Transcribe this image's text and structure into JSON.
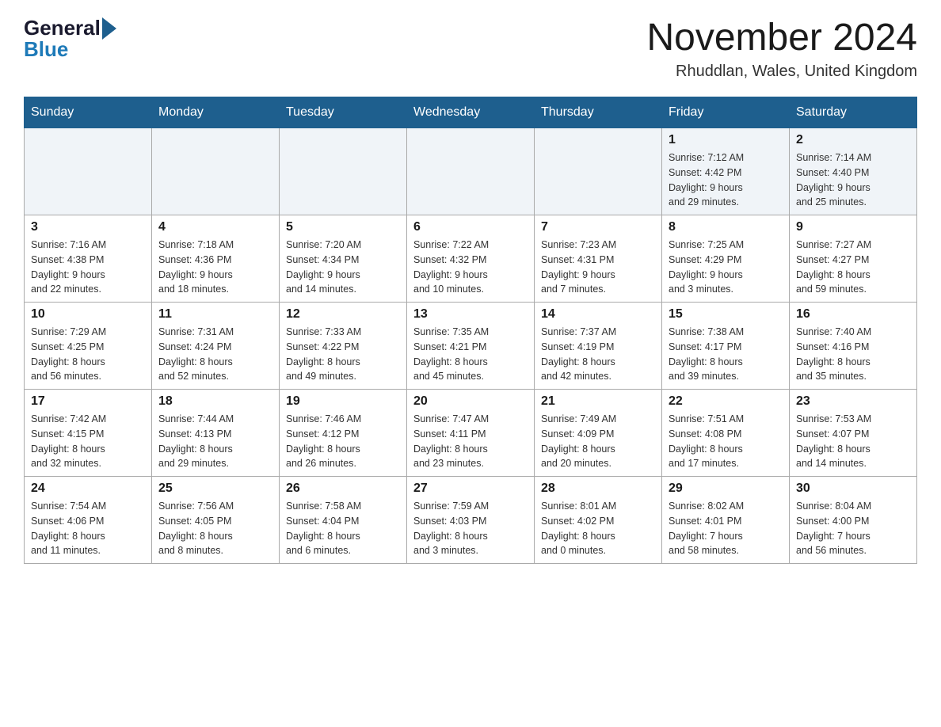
{
  "header": {
    "logo_general": "General",
    "logo_blue": "Blue",
    "month_title": "November 2024",
    "location": "Rhuddlan, Wales, United Kingdom"
  },
  "weekdays": [
    "Sunday",
    "Monday",
    "Tuesday",
    "Wednesday",
    "Thursday",
    "Friday",
    "Saturday"
  ],
  "weeks": [
    [
      {
        "day": "",
        "info": ""
      },
      {
        "day": "",
        "info": ""
      },
      {
        "day": "",
        "info": ""
      },
      {
        "day": "",
        "info": ""
      },
      {
        "day": "",
        "info": ""
      },
      {
        "day": "1",
        "info": "Sunrise: 7:12 AM\nSunset: 4:42 PM\nDaylight: 9 hours\nand 29 minutes."
      },
      {
        "day": "2",
        "info": "Sunrise: 7:14 AM\nSunset: 4:40 PM\nDaylight: 9 hours\nand 25 minutes."
      }
    ],
    [
      {
        "day": "3",
        "info": "Sunrise: 7:16 AM\nSunset: 4:38 PM\nDaylight: 9 hours\nand 22 minutes."
      },
      {
        "day": "4",
        "info": "Sunrise: 7:18 AM\nSunset: 4:36 PM\nDaylight: 9 hours\nand 18 minutes."
      },
      {
        "day": "5",
        "info": "Sunrise: 7:20 AM\nSunset: 4:34 PM\nDaylight: 9 hours\nand 14 minutes."
      },
      {
        "day": "6",
        "info": "Sunrise: 7:22 AM\nSunset: 4:32 PM\nDaylight: 9 hours\nand 10 minutes."
      },
      {
        "day": "7",
        "info": "Sunrise: 7:23 AM\nSunset: 4:31 PM\nDaylight: 9 hours\nand 7 minutes."
      },
      {
        "day": "8",
        "info": "Sunrise: 7:25 AM\nSunset: 4:29 PM\nDaylight: 9 hours\nand 3 minutes."
      },
      {
        "day": "9",
        "info": "Sunrise: 7:27 AM\nSunset: 4:27 PM\nDaylight: 8 hours\nand 59 minutes."
      }
    ],
    [
      {
        "day": "10",
        "info": "Sunrise: 7:29 AM\nSunset: 4:25 PM\nDaylight: 8 hours\nand 56 minutes."
      },
      {
        "day": "11",
        "info": "Sunrise: 7:31 AM\nSunset: 4:24 PM\nDaylight: 8 hours\nand 52 minutes."
      },
      {
        "day": "12",
        "info": "Sunrise: 7:33 AM\nSunset: 4:22 PM\nDaylight: 8 hours\nand 49 minutes."
      },
      {
        "day": "13",
        "info": "Sunrise: 7:35 AM\nSunset: 4:21 PM\nDaylight: 8 hours\nand 45 minutes."
      },
      {
        "day": "14",
        "info": "Sunrise: 7:37 AM\nSunset: 4:19 PM\nDaylight: 8 hours\nand 42 minutes."
      },
      {
        "day": "15",
        "info": "Sunrise: 7:38 AM\nSunset: 4:17 PM\nDaylight: 8 hours\nand 39 minutes."
      },
      {
        "day": "16",
        "info": "Sunrise: 7:40 AM\nSunset: 4:16 PM\nDaylight: 8 hours\nand 35 minutes."
      }
    ],
    [
      {
        "day": "17",
        "info": "Sunrise: 7:42 AM\nSunset: 4:15 PM\nDaylight: 8 hours\nand 32 minutes."
      },
      {
        "day": "18",
        "info": "Sunrise: 7:44 AM\nSunset: 4:13 PM\nDaylight: 8 hours\nand 29 minutes."
      },
      {
        "day": "19",
        "info": "Sunrise: 7:46 AM\nSunset: 4:12 PM\nDaylight: 8 hours\nand 26 minutes."
      },
      {
        "day": "20",
        "info": "Sunrise: 7:47 AM\nSunset: 4:11 PM\nDaylight: 8 hours\nand 23 minutes."
      },
      {
        "day": "21",
        "info": "Sunrise: 7:49 AM\nSunset: 4:09 PM\nDaylight: 8 hours\nand 20 minutes."
      },
      {
        "day": "22",
        "info": "Sunrise: 7:51 AM\nSunset: 4:08 PM\nDaylight: 8 hours\nand 17 minutes."
      },
      {
        "day": "23",
        "info": "Sunrise: 7:53 AM\nSunset: 4:07 PM\nDaylight: 8 hours\nand 14 minutes."
      }
    ],
    [
      {
        "day": "24",
        "info": "Sunrise: 7:54 AM\nSunset: 4:06 PM\nDaylight: 8 hours\nand 11 minutes."
      },
      {
        "day": "25",
        "info": "Sunrise: 7:56 AM\nSunset: 4:05 PM\nDaylight: 8 hours\nand 8 minutes."
      },
      {
        "day": "26",
        "info": "Sunrise: 7:58 AM\nSunset: 4:04 PM\nDaylight: 8 hours\nand 6 minutes."
      },
      {
        "day": "27",
        "info": "Sunrise: 7:59 AM\nSunset: 4:03 PM\nDaylight: 8 hours\nand 3 minutes."
      },
      {
        "day": "28",
        "info": "Sunrise: 8:01 AM\nSunset: 4:02 PM\nDaylight: 8 hours\nand 0 minutes."
      },
      {
        "day": "29",
        "info": "Sunrise: 8:02 AM\nSunset: 4:01 PM\nDaylight: 7 hours\nand 58 minutes."
      },
      {
        "day": "30",
        "info": "Sunrise: 8:04 AM\nSunset: 4:00 PM\nDaylight: 7 hours\nand 56 minutes."
      }
    ]
  ]
}
